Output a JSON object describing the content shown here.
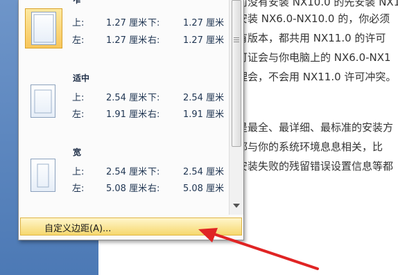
{
  "document": {
    "lines": [
      "前没有安装 NX10.0 的先安装 NX1",
      "安装 NX6.0-NX10.0 的，你必须",
      "有版本，都共用 NX11.0 的许可",
      "可证会与你电脑上的 NX6.0-NX1",
      "理会，不会用 NX11.0 许可冲突。",
      "",
      "是最全、最详细、最标准的安装方",
      "都与你的系统环境息息相关，比",
      "安装失败的残留错误设置信息等都"
    ]
  },
  "margins_menu": {
    "options": [
      {
        "title": "窄",
        "top_label": "上:",
        "top_value": "1.27 厘米",
        "bottom_label": "下:",
        "bottom_value": "1.27 厘米",
        "left_label": "左:",
        "left_value": "1.27 厘米",
        "right_label": "右:",
        "right_value": "1.27 厘米",
        "selected": true
      },
      {
        "title": "适中",
        "top_label": "上:",
        "top_value": "2.54 厘米",
        "bottom_label": "下:",
        "bottom_value": "2.54 厘米",
        "left_label": "左:",
        "left_value": "1.91 厘米",
        "right_label": "右:",
        "right_value": "1.91 厘米",
        "selected": false
      },
      {
        "title": "宽",
        "top_label": "上:",
        "top_value": "2.54 厘米",
        "bottom_label": "下:",
        "bottom_value": "2.54 厘米",
        "left_label": "左:",
        "left_value": "5.08 厘米",
        "right_label": "右:",
        "right_value": "5.08 厘米",
        "selected": false
      }
    ],
    "custom_label": "自定义边距(A)...",
    "icons": {
      "scroll_down": "chevron-down-icon",
      "annotation": "red-arrow-icon"
    },
    "colors": {
      "highlight": "#f6d86e",
      "annotation_arrow": "#e02424"
    }
  }
}
